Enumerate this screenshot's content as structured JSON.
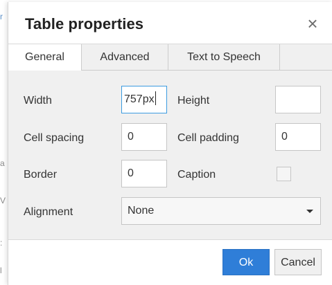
{
  "dialog": {
    "title": "Table properties",
    "close_icon": "close-icon",
    "close_glyph": "×"
  },
  "tabs": [
    {
      "label": "General",
      "active": true
    },
    {
      "label": "Advanced",
      "active": false
    },
    {
      "label": "Text to Speech",
      "active": false
    }
  ],
  "general": {
    "width_label": "Width",
    "width_value": "757px",
    "height_label": "Height",
    "height_value": "",
    "cell_spacing_label": "Cell spacing",
    "cell_spacing_value": "0",
    "cell_padding_label": "Cell padding",
    "cell_padding_value": "0",
    "border_label": "Border",
    "border_value": "0",
    "caption_label": "Caption",
    "caption_checked": false,
    "alignment_label": "Alignment",
    "alignment_value": "None"
  },
  "buttons": {
    "ok_label": "Ok",
    "cancel_label": "Cancel"
  },
  "colors": {
    "accent": "#2f7ed8",
    "focus_border": "#3b9be0",
    "panel_bg": "#f0f0f0"
  }
}
